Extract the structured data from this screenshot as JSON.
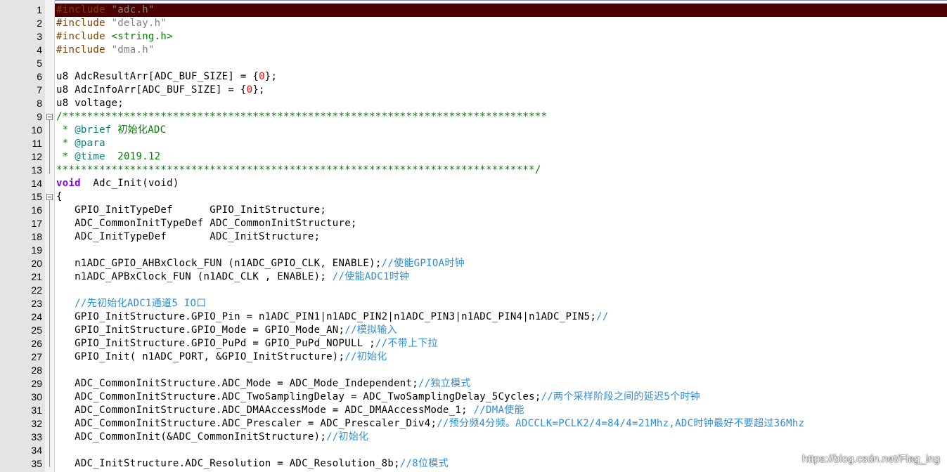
{
  "editor": {
    "current_line": 1,
    "lines": [
      {
        "n": "1",
        "fold": false,
        "tokens": [
          {
            "c": "t-pp",
            "t": "#include "
          },
          {
            "c": "t-str",
            "t": "\"adc.h\""
          }
        ]
      },
      {
        "n": "2",
        "fold": false,
        "tokens": [
          {
            "c": "t-pp",
            "t": "#include "
          },
          {
            "c": "t-str",
            "t": "\"delay.h\""
          }
        ]
      },
      {
        "n": "3",
        "fold": false,
        "tokens": [
          {
            "c": "t-pp",
            "t": "#include "
          },
          {
            "c": "t-inc",
            "t": "<string.h>"
          }
        ]
      },
      {
        "n": "4",
        "fold": false,
        "tokens": [
          {
            "c": "t-pp",
            "t": "#include "
          },
          {
            "c": "t-str",
            "t": "\"dma.h\""
          }
        ]
      },
      {
        "n": "5",
        "fold": false,
        "tokens": []
      },
      {
        "n": "6",
        "fold": false,
        "tokens": [
          {
            "c": "t-ident",
            "t": "u8 AdcResultArr[ADC_BUF_SIZE] = {"
          },
          {
            "c": "t-num",
            "t": "0"
          },
          {
            "c": "t-ident",
            "t": "};"
          }
        ]
      },
      {
        "n": "7",
        "fold": false,
        "tokens": [
          {
            "c": "t-ident",
            "t": "u8 AdcInfoArr[ADC_BUF_SIZE] = {"
          },
          {
            "c": "t-num",
            "t": "0"
          },
          {
            "c": "t-ident",
            "t": "};"
          }
        ]
      },
      {
        "n": "8",
        "fold": false,
        "tokens": [
          {
            "c": "t-ident",
            "t": "u8 voltage;"
          }
        ]
      },
      {
        "n": "9",
        "fold": true,
        "tokens": [
          {
            "c": "t-cm",
            "t": "/*******************************************************************************"
          }
        ]
      },
      {
        "n": "10",
        "fold": false,
        "tokens": [
          {
            "c": "t-cm",
            "t": " * "
          },
          {
            "c": "t-tag",
            "t": "@brief"
          },
          {
            "c": "t-cm",
            "t": " 初始化ADC"
          }
        ]
      },
      {
        "n": "11",
        "fold": false,
        "tokens": [
          {
            "c": "t-cm",
            "t": " * "
          },
          {
            "c": "t-tag",
            "t": "@para"
          }
        ]
      },
      {
        "n": "12",
        "fold": false,
        "tokens": [
          {
            "c": "t-cm",
            "t": " * "
          },
          {
            "c": "t-tag",
            "t": "@time"
          },
          {
            "c": "t-cm",
            "t": "  2019.12"
          }
        ]
      },
      {
        "n": "13",
        "fold": false,
        "tokens": [
          {
            "c": "t-cm",
            "t": "******************************************************************************/"
          }
        ]
      },
      {
        "n": "14",
        "fold": false,
        "tokens": [
          {
            "c": "t-kw",
            "t": "void"
          },
          {
            "c": "t-ident",
            "t": "  Adc_Init(void)"
          }
        ]
      },
      {
        "n": "15",
        "fold": true,
        "tokens": [
          {
            "c": "t-ident",
            "t": "{"
          }
        ]
      },
      {
        "n": "16",
        "fold": false,
        "tokens": [
          {
            "c": "t-ident",
            "t": "   GPIO_InitTypeDef      GPIO_InitStructure;"
          }
        ]
      },
      {
        "n": "17",
        "fold": false,
        "tokens": [
          {
            "c": "t-ident",
            "t": "   ADC_CommonInitTypeDef ADC_CommonInitStructure;"
          }
        ]
      },
      {
        "n": "18",
        "fold": false,
        "tokens": [
          {
            "c": "t-ident",
            "t": "   ADC_InitTypeDef       ADC_InitStructure;"
          }
        ]
      },
      {
        "n": "19",
        "fold": false,
        "tokens": []
      },
      {
        "n": "20",
        "fold": false,
        "tokens": [
          {
            "c": "t-ident",
            "t": "   n1ADC_GPIO_AHBxClock_FUN (n1ADC_GPIO_CLK, ENABLE);"
          },
          {
            "c": "t-cn",
            "t": "//使能GPIOA时钟"
          }
        ]
      },
      {
        "n": "21",
        "fold": false,
        "tokens": [
          {
            "c": "t-ident",
            "t": "   n1ADC_APBxClock_FUN (n1ADC_CLK , ENABLE); "
          },
          {
            "c": "t-cn",
            "t": "//使能ADC1时钟"
          }
        ]
      },
      {
        "n": "22",
        "fold": false,
        "tokens": []
      },
      {
        "n": "23",
        "fold": false,
        "tokens": [
          {
            "c": "t-cn",
            "t": "   //先初始化ADC1通道5 IO口"
          }
        ]
      },
      {
        "n": "24",
        "fold": false,
        "tokens": [
          {
            "c": "t-ident",
            "t": "   GPIO_InitStructure.GPIO_Pin = n1ADC_PIN1|n1ADC_PIN2|n1ADC_PIN3|n1ADC_PIN4|n1ADC_PIN5;"
          },
          {
            "c": "t-cn",
            "t": "//"
          }
        ]
      },
      {
        "n": "25",
        "fold": false,
        "tokens": [
          {
            "c": "t-ident",
            "t": "   GPIO_InitStructure.GPIO_Mode = GPIO_Mode_AN;"
          },
          {
            "c": "t-cn",
            "t": "//模拟输入"
          }
        ]
      },
      {
        "n": "26",
        "fold": false,
        "tokens": [
          {
            "c": "t-ident",
            "t": "   GPIO_InitStructure.GPIO_PuPd = GPIO_PuPd_NOPULL ;"
          },
          {
            "c": "t-cn",
            "t": "//不带上下拉"
          }
        ]
      },
      {
        "n": "27",
        "fold": false,
        "tokens": [
          {
            "c": "t-ident",
            "t": "   GPIO_Init( n1ADC_PORT, &GPIO_InitStructure);"
          },
          {
            "c": "t-cn",
            "t": "//初始化"
          }
        ]
      },
      {
        "n": "28",
        "fold": false,
        "tokens": []
      },
      {
        "n": "29",
        "fold": false,
        "tokens": [
          {
            "c": "t-ident",
            "t": "   ADC_CommonInitStructure.ADC_Mode = ADC_Mode_Independent;"
          },
          {
            "c": "t-cn",
            "t": "//独立模式"
          }
        ]
      },
      {
        "n": "30",
        "fold": false,
        "tokens": [
          {
            "c": "t-ident",
            "t": "   ADC_CommonInitStructure.ADC_TwoSamplingDelay = ADC_TwoSamplingDelay_5Cycles;"
          },
          {
            "c": "t-cn",
            "t": "//两个采样阶段之间的延迟5个时钟"
          }
        ]
      },
      {
        "n": "31",
        "fold": false,
        "tokens": [
          {
            "c": "t-ident",
            "t": "   ADC_CommonInitStructure.ADC_DMAAccessMode = ADC_DMAAccessMode_1; "
          },
          {
            "c": "t-cn",
            "t": "//DMA使能"
          }
        ]
      },
      {
        "n": "32",
        "fold": false,
        "tokens": [
          {
            "c": "t-ident",
            "t": "   ADC_CommonInitStructure.ADC_Prescaler = ADC_Prescaler_Div4;"
          },
          {
            "c": "t-cn",
            "t": "//预分频4分频。ADCCLK=PCLK2/4=84/4=21Mhz,ADC时钟最好不要超过36Mhz"
          }
        ]
      },
      {
        "n": "33",
        "fold": false,
        "tokens": [
          {
            "c": "t-ident",
            "t": "   ADC_CommonInit(&ADC_CommonInitStructure);"
          },
          {
            "c": "t-cn",
            "t": "//初始化"
          }
        ]
      },
      {
        "n": "34",
        "fold": false,
        "tokens": []
      },
      {
        "n": "35",
        "fold": false,
        "tokens": [
          {
            "c": "t-ident",
            "t": "   ADC_InitStructure.ADC_Resolution = ADC_Resolution_8b;"
          },
          {
            "c": "t-cn",
            "t": "//8位模式"
          }
        ]
      }
    ]
  },
  "watermark": "https://blog.csdn.net/Flag_ing"
}
